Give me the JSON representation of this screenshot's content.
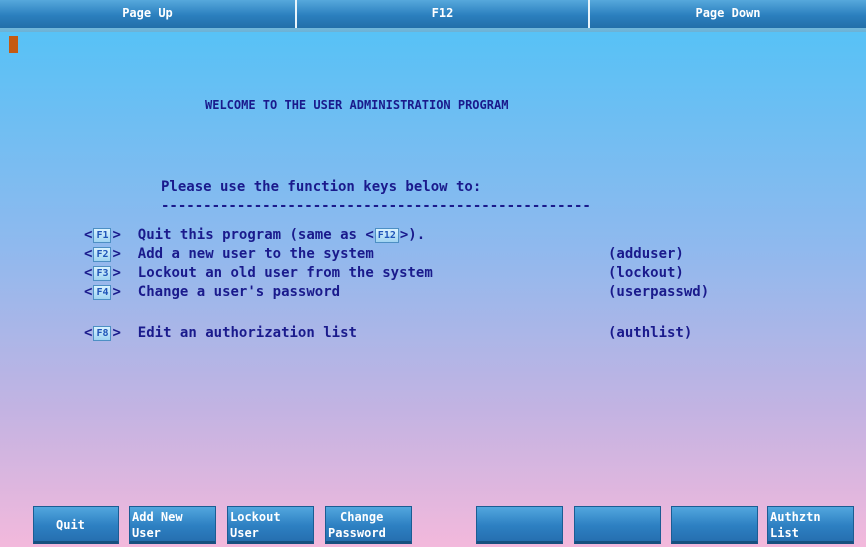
{
  "top_tabs": {
    "page_up": "Page Up",
    "f12": "F12",
    "page_down": "Page Down"
  },
  "screen": {
    "title": "WELCOME TO THE USER ADMINISTRATION PROGRAM",
    "intro": "Please use the function keys below to:",
    "rule": "---------------------------------------------------",
    "options": [
      {
        "key": "F1",
        "desc": "Quit this program (same as",
        "key2": "F12",
        "desc_end": ").",
        "command": ""
      },
      {
        "key": "F2",
        "desc": "Add a new user to the system",
        "command": "(adduser)"
      },
      {
        "key": "F3",
        "desc": "Lockout an old user from the system",
        "command": "(lockout)"
      },
      {
        "key": "F4",
        "desc": "Change a user's password",
        "command": "(userpasswd)"
      },
      {
        "key": "F8",
        "desc": "Edit an authorization list",
        "command": "(authlist)"
      }
    ]
  },
  "function_keys": [
    {
      "line1": "Quit",
      "line2": ""
    },
    {
      "line1": "Add New",
      "line2": "User"
    },
    {
      "line1": "Lockout",
      "line2": "User"
    },
    {
      "line1": "Change",
      "line2": "Password"
    },
    {
      "line1": "",
      "line2": ""
    },
    {
      "line1": "",
      "line2": ""
    },
    {
      "line1": "",
      "line2": ""
    },
    {
      "line1": "Authztn",
      "line2": "List"
    }
  ],
  "colors": {
    "text": "#1a1a8c",
    "button": "#2d80c2",
    "cursor": "#c55a11"
  }
}
